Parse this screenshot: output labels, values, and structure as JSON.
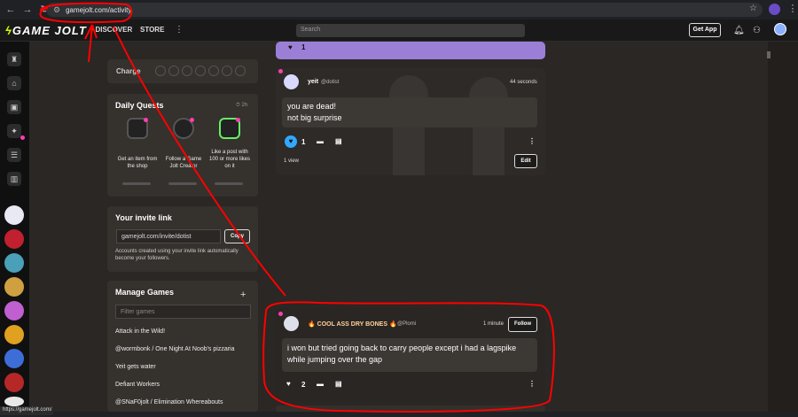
{
  "browser": {
    "url": "gamejolt.com/activity"
  },
  "topnav": {
    "logo": "GAME JOLT",
    "discover": "DISCOVER",
    "store": "STORE",
    "search_placeholder": "Search",
    "get_app": "Get App"
  },
  "sidebar": {
    "charge_label": "Charge",
    "daily_quests": {
      "title": "Daily Quests",
      "timer": "2h",
      "quests": [
        {
          "label": "Get an item from the shop"
        },
        {
          "label": "Follow a Game Jolt Creator"
        },
        {
          "label": "Like a post with 100 or more likes on it"
        }
      ]
    },
    "invite": {
      "title": "Your invite link",
      "link": "gamejolt.com/invite/dotist",
      "copy": "Copy",
      "desc": "Accounts created using your invite link automatically become your followers."
    },
    "manage_games": {
      "title": "Manage Games",
      "filter_placeholder": "Filter games",
      "games": [
        "Attack in the Wild!",
        "@wormbonk / One Night At Noob's pizzaria",
        "Yeit gets water",
        "Defiant Workers",
        "@SNaF0jolt / Elimination Whereabouts"
      ]
    }
  },
  "feed": {
    "posts": [
      {
        "author": "yeit",
        "handle": "@dotist",
        "time": "44 seconds",
        "lines": [
          "you are dead!",
          "not big surprise"
        ],
        "likes": "1",
        "views": "1 view",
        "edit": "Edit"
      },
      {
        "author": "🔥 COOL ASS DRY BONES 🔥",
        "handle": "@Plomi",
        "time": "1 minute",
        "follow": "Follow",
        "text": "i won but tried going back to carry people except i had a lagspike while jumping over the gap",
        "likes": "2"
      }
    ],
    "prev_post_likes": "1"
  },
  "status_bar": "https://gamejolt.com/",
  "colors": {
    "background": "#2a2724",
    "card": "#35312d",
    "accent_pink": "#ff3fac",
    "like_blue": "#2fa9ff",
    "annotation_red": "#ff0000"
  }
}
